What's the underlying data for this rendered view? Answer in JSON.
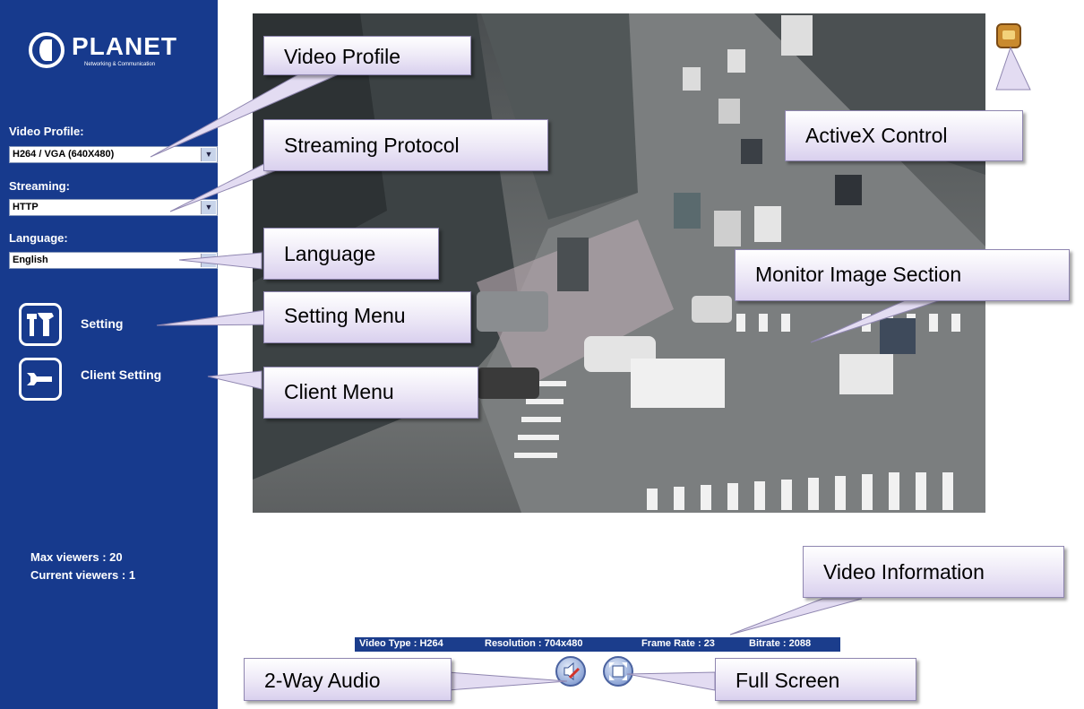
{
  "sidebar": {
    "logo": {
      "brand": "PLANET",
      "tagline": "Networking & Communication"
    },
    "video_profile": {
      "label": "Video Profile:",
      "value": "H264 / VGA (640X480)"
    },
    "streaming": {
      "label": "Streaming:",
      "value": "HTTP"
    },
    "language": {
      "label": "Language:",
      "value": "English"
    },
    "menu": {
      "setting": "Setting",
      "client_setting": "Client Setting"
    },
    "max_viewers": "Max viewers : 20",
    "current_viewers": "Current viewers :  1"
  },
  "video_info": {
    "type": "Video Type : H264",
    "resolution": "Resolution : 704x480",
    "frame_rate": "Frame Rate : 23",
    "bitrate": "Bitrate : 2088"
  },
  "callouts": {
    "video_profile": "Video Profile",
    "streaming_protocol": "Streaming Protocol",
    "language": "Language",
    "setting_menu": "Setting Menu",
    "client_menu": "Client Menu",
    "activex": "ActiveX Control",
    "monitor": "Monitor Image Section",
    "video_information": "Video Information",
    "two_way_audio": "2-Way Audio",
    "full_screen": "Full Screen"
  },
  "icons": {
    "activex": "activex-plugin-icon",
    "audio": "speaker-muted-icon",
    "fullscreen": "fullscreen-icon",
    "setting": "tools-icon",
    "client_setting": "wrench-icon"
  },
  "colors": {
    "sidebar": "#173a8d",
    "callout_fill": "#e6e0f4"
  }
}
